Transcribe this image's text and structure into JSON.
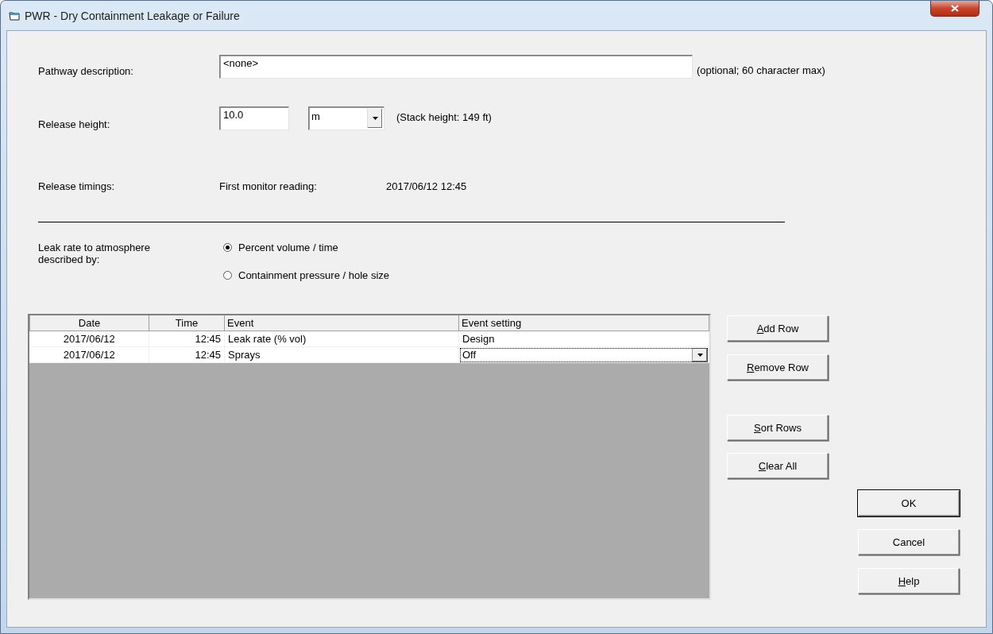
{
  "window": {
    "title": "PWR - Dry Containment Leakage or Failure"
  },
  "pathway": {
    "label": "Pathway description:",
    "value": "<none>",
    "note": "(optional; 60 character max)"
  },
  "release_height": {
    "label": "Release height:",
    "value": "10.0",
    "unit": "m",
    "note": "(Stack height: 149 ft)"
  },
  "release_timings": {
    "label": "Release timings:",
    "name": "First monitor reading:",
    "value": "2017/06/12 12:45"
  },
  "leak_rate": {
    "label": "Leak rate to atmosphere described by:",
    "options": [
      {
        "label": "Percent volume / time",
        "selected": true
      },
      {
        "label": "Containment pressure / hole size",
        "selected": false
      }
    ]
  },
  "table": {
    "columns": [
      "Date",
      "Time",
      "Event",
      "Event setting"
    ],
    "rows": [
      {
        "date": "2017/06/12",
        "time": "12:45",
        "event": "Leak rate (% vol)",
        "setting": "Design",
        "editing": false
      },
      {
        "date": "2017/06/12",
        "time": "12:45",
        "event": "Sprays",
        "setting": "Off",
        "editing": true
      }
    ]
  },
  "row_buttons": [
    {
      "label": "Add Row",
      "mnemonic": true
    },
    {
      "label": "Remove Row",
      "mnemonic": true
    },
    {
      "label": "Sort Rows",
      "mnemonic": true
    },
    {
      "label": "Clear All",
      "mnemonic": true
    }
  ],
  "dialog_buttons": [
    {
      "label": "OK",
      "mnemonic": false,
      "default": true
    },
    {
      "label": "Cancel",
      "mnemonic": false,
      "default": false
    },
    {
      "label": "Help",
      "mnemonic": true,
      "default": false
    }
  ]
}
